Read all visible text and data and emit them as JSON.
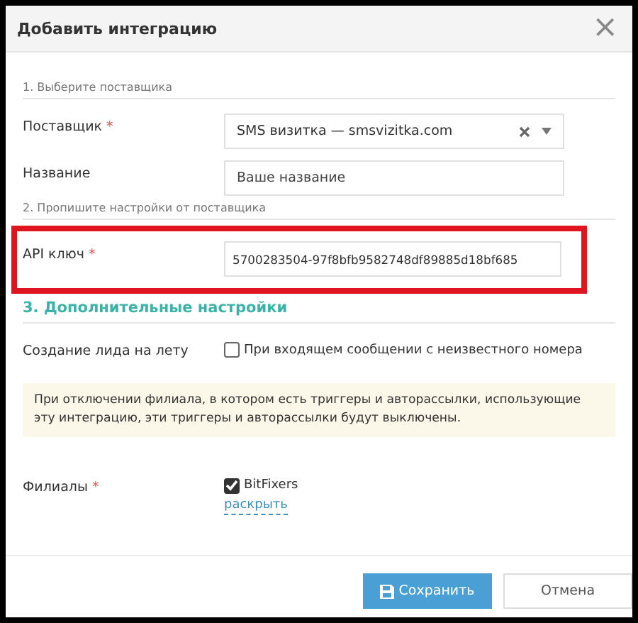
{
  "dialog": {
    "title": "Добавить интеграцию",
    "close": "×"
  },
  "sections": [
    {
      "heading": "1. Выберите поставщика",
      "kind": "plain",
      "fields": [
        {
          "kind": "select",
          "label": "Поставщик",
          "required_mark": "*",
          "value": "SMS визитка — smsvizitka.com",
          "highlighted": false
        },
        {
          "kind": "input",
          "label": "Название",
          "placeholder": "Ваше название",
          "highlighted": false
        }
      ]
    },
    {
      "heading": "2. Пропишите настройки от поставщика",
      "kind": "plain",
      "fields": [
        {
          "kind": "input",
          "label": "API ключ",
          "required_mark": "*",
          "value": "5700283504-97f8bfb9582748df89885d18bf685",
          "highlighted": true
        }
      ]
    },
    {
      "heading": "3. Дополнительные настройки",
      "kind": "accent",
      "fields": [
        {
          "kind": "checkbox",
          "label": "Создание лида на лету",
          "option": "При входящем сообщении с неизвестного номера",
          "checked": false,
          "highlighted": false
        },
        {
          "kind": "notice",
          "text": "При отключении филиала, в котором есть триггеры и авторассылки, использующие эту интеграцию, эти триггеры и авторассылки будут выключены."
        },
        {
          "kind": "checkbox",
          "label": "Филиалы",
          "required_mark": "*",
          "option": "BitFixers",
          "checked": true,
          "link": "раскрыть",
          "highlighted": false
        }
      ]
    }
  ],
  "buttons": [
    {
      "label": "Сохранить",
      "primary": true
    },
    {
      "label": "Отмена",
      "primary": false
    }
  ]
}
